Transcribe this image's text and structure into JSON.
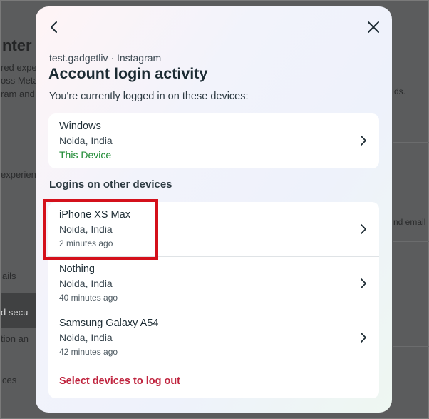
{
  "background_page": {
    "title_fragment": "nter",
    "lines": [
      "red expe",
      "oss Meta",
      "ram and",
      "experien",
      "ails",
      "d secu",
      "tion an",
      "ces"
    ],
    "right_fragments": [
      "ds.",
      "nd email"
    ]
  },
  "modal": {
    "account_line": "test.gadgetliv · Instagram",
    "title": "Account login activity",
    "subtitle": "You're currently logged in on these devices:",
    "current_device": {
      "name": "Windows",
      "location": "Noida, India",
      "status": "This Device"
    },
    "other_section_heading": "Logins on other devices",
    "other_devices": [
      {
        "name": "iPhone XS Max",
        "location": "Noida, India",
        "time": "2 minutes ago"
      },
      {
        "name": "Nothing",
        "location": "Noida, India",
        "time": "40 minutes ago"
      },
      {
        "name": "Samsung Galaxy A54",
        "location": "Noida, India",
        "time": "42 minutes ago"
      }
    ],
    "logout_link": "Select devices to log out"
  },
  "colors": {
    "this_device_green": "#1d8a33",
    "logout_red": "#c0253f",
    "highlight_red": "#d4101b"
  },
  "icons": [
    "back-arrow-icon",
    "close-icon",
    "chevron-right-icon"
  ]
}
